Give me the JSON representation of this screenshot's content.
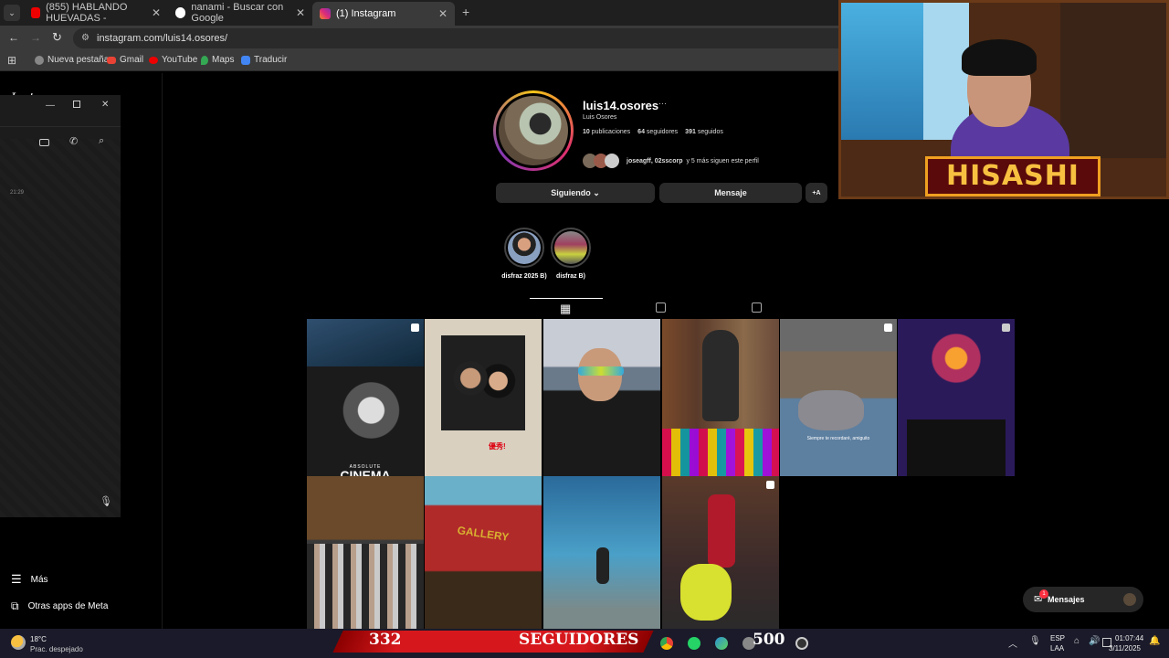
{
  "browser": {
    "tabs": [
      {
        "label": "(855) HABLANDO HUEVADAS -",
        "active": false
      },
      {
        "label": "nanami - Buscar con Google",
        "active": false
      },
      {
        "label": "(1) Instagram",
        "active": true
      }
    ],
    "url": "instagram.com/luis14.osores/",
    "bookmarks": [
      "Nueva pestaña",
      "Gmail",
      "YouTube",
      "Maps",
      "Traducir"
    ]
  },
  "left": {
    "app_title": "Instagram",
    "time": "21:29",
    "more": "Más",
    "meta_apps": "Otras apps de Meta"
  },
  "profile": {
    "username": "luis14.osores",
    "more_dots": "···",
    "full_name": "Luis Osores",
    "posts": "10",
    "posts_label": "publicaciones",
    "followers": "64",
    "followers_label": "seguidores",
    "following": "391",
    "following_label": "seguidos",
    "followed_by_names": "joseagff, 02sscorp",
    "followed_by_rest": "y 5 más siguen este perfil",
    "following_button": "Siguiendo",
    "message_button": "Mensaje",
    "add_button": "+A"
  },
  "highlights": [
    {
      "label": "disfraz 2025 B)"
    },
    {
      "label": "disfraz B)"
    }
  ],
  "posts_grid": {
    "captions": [
      "ABSOLUTE",
      "CINEMA",
      "Siempre te recordaré, amiguito",
      "GALLERY"
    ]
  },
  "messages_bubble": {
    "label": "Mensajes",
    "badge": "1"
  },
  "overlay": {
    "streamer_name": "HISASHI",
    "counter_value": "332",
    "counter_label": "SEGUIDORES",
    "goal": "500"
  },
  "taskbar": {
    "temp": "18°C",
    "weather": "Prac. despejado",
    "lang1": "ESP",
    "lang2": "LAA",
    "time": "01:07:44",
    "date": "3/11/2025"
  }
}
